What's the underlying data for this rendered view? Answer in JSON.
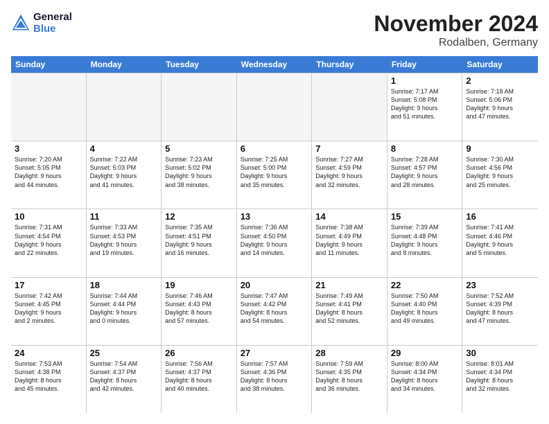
{
  "logo": {
    "line1": "General",
    "line2": "Blue"
  },
  "title": "November 2024",
  "location": "Rodalben, Germany",
  "weekdays": [
    "Sunday",
    "Monday",
    "Tuesday",
    "Wednesday",
    "Thursday",
    "Friday",
    "Saturday"
  ],
  "rows": [
    [
      {
        "day": "",
        "empty": true
      },
      {
        "day": "",
        "empty": true
      },
      {
        "day": "",
        "empty": true
      },
      {
        "day": "",
        "empty": true
      },
      {
        "day": "",
        "empty": true
      },
      {
        "day": "1",
        "info": "Sunrise: 7:17 AM\nSunset: 5:08 PM\nDaylight: 9 hours\nand 51 minutes."
      },
      {
        "day": "2",
        "info": "Sunrise: 7:18 AM\nSunset: 5:06 PM\nDaylight: 9 hours\nand 47 minutes."
      }
    ],
    [
      {
        "day": "3",
        "info": "Sunrise: 7:20 AM\nSunset: 5:05 PM\nDaylight: 9 hours\nand 44 minutes."
      },
      {
        "day": "4",
        "info": "Sunrise: 7:22 AM\nSunset: 5:03 PM\nDaylight: 9 hours\nand 41 minutes."
      },
      {
        "day": "5",
        "info": "Sunrise: 7:23 AM\nSunset: 5:02 PM\nDaylight: 9 hours\nand 38 minutes."
      },
      {
        "day": "6",
        "info": "Sunrise: 7:25 AM\nSunset: 5:00 PM\nDaylight: 9 hours\nand 35 minutes."
      },
      {
        "day": "7",
        "info": "Sunrise: 7:27 AM\nSunset: 4:59 PM\nDaylight: 9 hours\nand 32 minutes."
      },
      {
        "day": "8",
        "info": "Sunrise: 7:28 AM\nSunset: 4:57 PM\nDaylight: 9 hours\nand 28 minutes."
      },
      {
        "day": "9",
        "info": "Sunrise: 7:30 AM\nSunset: 4:56 PM\nDaylight: 9 hours\nand 25 minutes."
      }
    ],
    [
      {
        "day": "10",
        "info": "Sunrise: 7:31 AM\nSunset: 4:54 PM\nDaylight: 9 hours\nand 22 minutes."
      },
      {
        "day": "11",
        "info": "Sunrise: 7:33 AM\nSunset: 4:53 PM\nDaylight: 9 hours\nand 19 minutes."
      },
      {
        "day": "12",
        "info": "Sunrise: 7:35 AM\nSunset: 4:51 PM\nDaylight: 9 hours\nand 16 minutes."
      },
      {
        "day": "13",
        "info": "Sunrise: 7:36 AM\nSunset: 4:50 PM\nDaylight: 9 hours\nand 14 minutes."
      },
      {
        "day": "14",
        "info": "Sunrise: 7:38 AM\nSunset: 4:49 PM\nDaylight: 9 hours\nand 11 minutes."
      },
      {
        "day": "15",
        "info": "Sunrise: 7:39 AM\nSunset: 4:48 PM\nDaylight: 9 hours\nand 8 minutes."
      },
      {
        "day": "16",
        "info": "Sunrise: 7:41 AM\nSunset: 4:46 PM\nDaylight: 9 hours\nand 5 minutes."
      }
    ],
    [
      {
        "day": "17",
        "info": "Sunrise: 7:42 AM\nSunset: 4:45 PM\nDaylight: 9 hours\nand 2 minutes."
      },
      {
        "day": "18",
        "info": "Sunrise: 7:44 AM\nSunset: 4:44 PM\nDaylight: 9 hours\nand 0 minutes."
      },
      {
        "day": "19",
        "info": "Sunrise: 7:46 AM\nSunset: 4:43 PM\nDaylight: 8 hours\nand 57 minutes."
      },
      {
        "day": "20",
        "info": "Sunrise: 7:47 AM\nSunset: 4:42 PM\nDaylight: 8 hours\nand 54 minutes."
      },
      {
        "day": "21",
        "info": "Sunrise: 7:49 AM\nSunset: 4:41 PM\nDaylight: 8 hours\nand 52 minutes."
      },
      {
        "day": "22",
        "info": "Sunrise: 7:50 AM\nSunset: 4:40 PM\nDaylight: 8 hours\nand 49 minutes."
      },
      {
        "day": "23",
        "info": "Sunrise: 7:52 AM\nSunset: 4:39 PM\nDaylight: 8 hours\nand 47 minutes."
      }
    ],
    [
      {
        "day": "24",
        "info": "Sunrise: 7:53 AM\nSunset: 4:38 PM\nDaylight: 8 hours\nand 45 minutes."
      },
      {
        "day": "25",
        "info": "Sunrise: 7:54 AM\nSunset: 4:37 PM\nDaylight: 8 hours\nand 42 minutes."
      },
      {
        "day": "26",
        "info": "Sunrise: 7:56 AM\nSunset: 4:37 PM\nDaylight: 8 hours\nand 40 minutes."
      },
      {
        "day": "27",
        "info": "Sunrise: 7:57 AM\nSunset: 4:36 PM\nDaylight: 8 hours\nand 38 minutes."
      },
      {
        "day": "28",
        "info": "Sunrise: 7:59 AM\nSunset: 4:35 PM\nDaylight: 8 hours\nand 36 minutes."
      },
      {
        "day": "29",
        "info": "Sunrise: 8:00 AM\nSunset: 4:34 PM\nDaylight: 8 hours\nand 34 minutes."
      },
      {
        "day": "30",
        "info": "Sunrise: 8:01 AM\nSunset: 4:34 PM\nDaylight: 8 hours\nand 32 minutes."
      }
    ]
  ]
}
